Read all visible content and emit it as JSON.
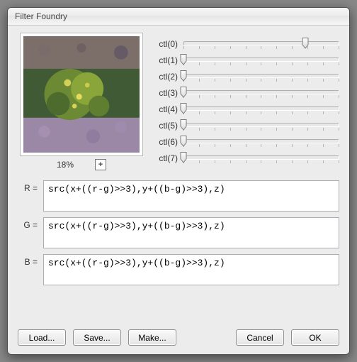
{
  "title": "Filter Foundry",
  "preview": {
    "zoom_label": "18%",
    "zoom_icon": "zoom-in"
  },
  "sliders": [
    {
      "label": "ctl(0)",
      "value": 0.78
    },
    {
      "label": "ctl(1)",
      "value": 0.0
    },
    {
      "label": "ctl(2)",
      "value": 0.0
    },
    {
      "label": "ctl(3)",
      "value": 0.0
    },
    {
      "label": "ctl(4)",
      "value": 0.0
    },
    {
      "label": "ctl(5)",
      "value": 0.0
    },
    {
      "label": "ctl(6)",
      "value": 0.0
    },
    {
      "label": "ctl(7)",
      "value": 0.0
    }
  ],
  "formulas": {
    "r": {
      "label": "R =",
      "expr": "src(x+((r-g)>>3),y+((b-g)>>3),z)"
    },
    "g": {
      "label": "G =",
      "expr": "src(x+((r-g)>>3),y+((b-g)>>3),z)"
    },
    "b": {
      "label": "B =",
      "expr": "src(x+((r-g)>>3),y+((b-g)>>3),z)"
    }
  },
  "buttons": {
    "load": "Load...",
    "save": "Save...",
    "make": "Make...",
    "cancel": "Cancel",
    "ok": "OK"
  }
}
